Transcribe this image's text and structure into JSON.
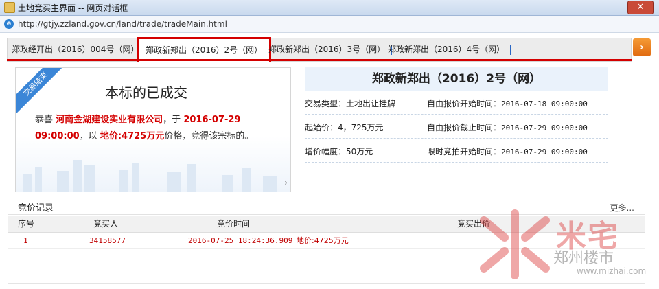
{
  "window": {
    "title": "土地竞买主界面 -- 网页对话框",
    "close_label": "✕"
  },
  "address": {
    "url": "http://gtjy.zzland.gov.cn/land/trade/tradeMain.html"
  },
  "tabs": [
    {
      "label": "郑政经开出（2016）004号（网）"
    },
    {
      "label": "郑政新郑出（2016）2号（网）"
    },
    {
      "label": "郑政新郑出（2016）3号（网）"
    },
    {
      "label": "郑政新郑出（2016）4号（网）"
    }
  ],
  "tab_scroll_label": "›",
  "result": {
    "ribbon": "交易结束",
    "heading": "本标的已成交",
    "msg_prefix": "恭喜",
    "company": "河南金湖建设实业有限公司",
    "msg_mid": "，于",
    "datetime": "2016-07-29 09:00:00",
    "msg_price_prefix": "，以",
    "price": "地价:4725万元",
    "msg_suffix": "价格，竞得该宗标的。",
    "more_arrow": "›"
  },
  "info": {
    "title": "郑政新郑出（2016）2号（网）",
    "rows": [
      {
        "left": "交易类型：土地出让挂牌",
        "right_label": "自由报价开始时间：",
        "right_value": "2016-07-18 09:00:00"
      },
      {
        "left": "起始价：4，725万元",
        "right_label": "自由报价截止时间：",
        "right_value": "2016-07-29 09:00:00"
      },
      {
        "left": "增价幅度：50万元",
        "right_label": "限时竞拍开始时间：",
        "right_value": "2016-07-29 09:00:00"
      }
    ]
  },
  "bids": {
    "title": "竞价记录",
    "more": "更多...",
    "columns": [
      "序号",
      "竞买人",
      "竞价时间",
      "竞买出价"
    ],
    "rows": [
      {
        "no": "1",
        "bidder": "34158577",
        "time": "2016-07-25 18:24:36.909",
        "amount": "地价:4725万元"
      }
    ]
  },
  "watermark": {
    "brand": "米宅",
    "sub": "郑州楼市",
    "site": "www.mizhai.com"
  },
  "colors": {
    "accent_red": "#d40000",
    "tab_blue": "#2a67c4",
    "ribbon_blue": "#3b86d7",
    "orange": "#e06a10"
  }
}
